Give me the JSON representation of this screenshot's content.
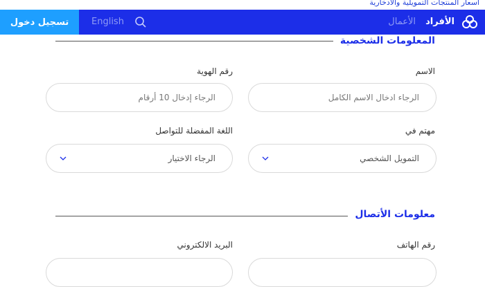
{
  "top_link": "أسعار المنتجات التمويلية والادخارية",
  "nav": {
    "individuals": "الأفراد",
    "business": "الأعمال",
    "language": "English",
    "login": "تسجيل دخول"
  },
  "icons": {
    "logo": "bank-logo-icon",
    "search": "search-icon",
    "chevron": "chevron-down-icon"
  },
  "colors": {
    "primary": "#1c2ee8",
    "login_button": "#1e9fff"
  },
  "personal": {
    "title": "المعلومات الشخصية",
    "name_label": "الاسم",
    "name_placeholder": "الرجاء ادخال الاسم الكامل",
    "id_label": "رقم الهوية",
    "id_placeholder": "الرجاء إدخال 10 أرقام",
    "interest_label": "مهتم في",
    "interest_value": "التمويل الشخصي",
    "language_label": "اللغة المفضلة للتواصل",
    "language_placeholder": "الرجاء الاختيار"
  },
  "contact": {
    "title": "معلومات الأتصال",
    "phone_label": "رقم الهاتف",
    "email_label": "البريد الالكتروني"
  }
}
